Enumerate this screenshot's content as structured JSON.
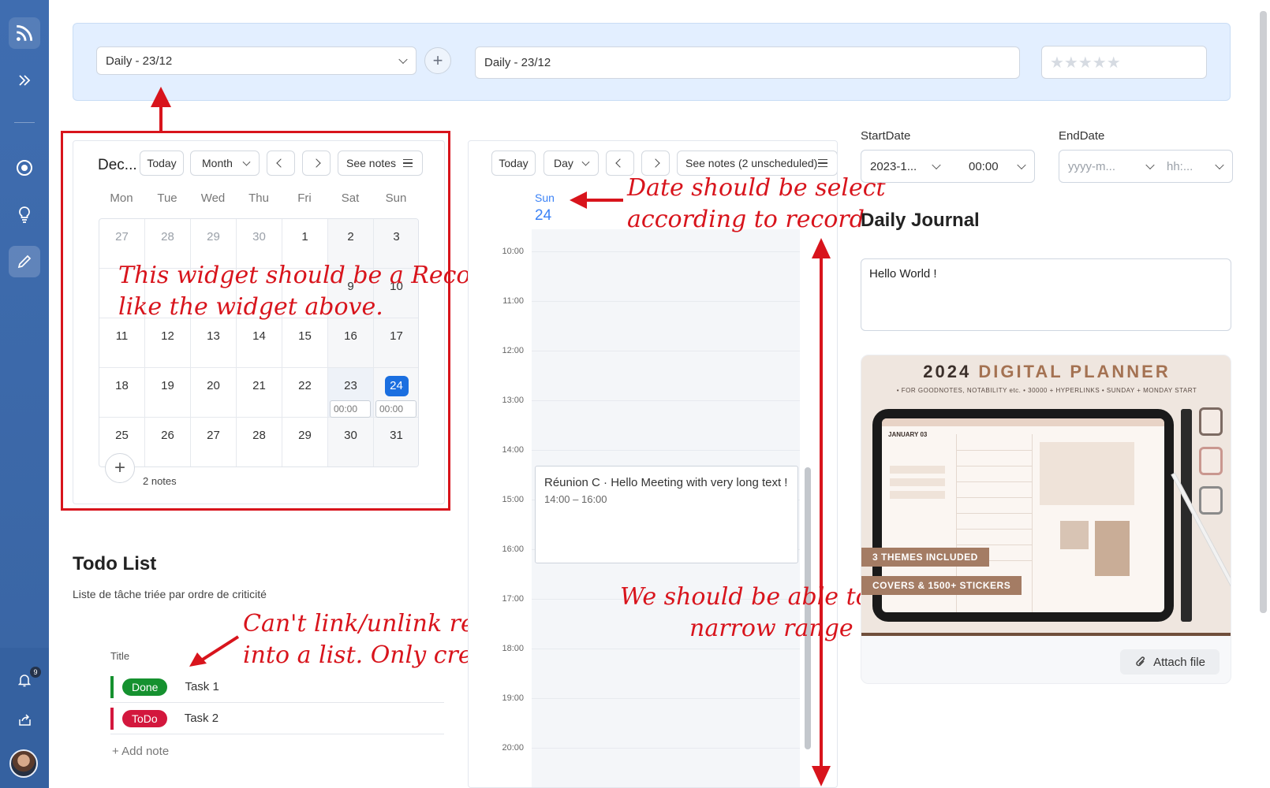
{
  "sidebar": {
    "notification_count": "9"
  },
  "topbar": {
    "record_select_value": "Daily - 23/12",
    "record_name_value": "Daily - 23/12",
    "rating_stars": "★★★★★"
  },
  "month_calendar": {
    "title": "Dec...",
    "today_label": "Today",
    "view_label": "Month",
    "see_notes_label": "See notes",
    "weekdays": [
      "Mon",
      "Tue",
      "Wed",
      "Thu",
      "Fri",
      "Sat",
      "Sun"
    ],
    "rows": [
      [
        "27",
        "28",
        "29",
        "30",
        "1",
        "2",
        "3"
      ],
      [
        "",
        "",
        "",
        "",
        "",
        "9",
        "10"
      ],
      [
        "11",
        "12",
        "13",
        "14",
        "15",
        "16",
        "17"
      ],
      [
        "18",
        "19",
        "20",
        "21",
        "22",
        "23",
        "24"
      ],
      [
        "25",
        "26",
        "27",
        "28",
        "29",
        "30",
        "31"
      ]
    ],
    "time_chip": "00:00",
    "notes_count": "2 notes"
  },
  "day_calendar": {
    "today_label": "Today",
    "view_label": "Day",
    "see_notes_label": "See notes (2 unscheduled)",
    "day_of_week": "Sun",
    "day_number": "24",
    "hours": [
      "10:00",
      "11:00",
      "12:00",
      "13:00",
      "14:00",
      "15:00",
      "16:00",
      "17:00",
      "18:00",
      "19:00",
      "20:00"
    ],
    "event": {
      "title": "Réunion C · Hello Meeting with very long text !",
      "time": "14:00 – 16:00"
    }
  },
  "todo": {
    "title": "Todo List",
    "subtitle": "Liste de tâche triée par ordre de criticité",
    "column_title": "Title",
    "items": [
      {
        "status": "Done",
        "task": "Task 1",
        "color": "#15912f"
      },
      {
        "status": "ToDo",
        "task": "Task 2",
        "color": "#d3173d"
      }
    ],
    "add_note_label": "Add note"
  },
  "details": {
    "start_label": "StartDate",
    "end_label": "EndDate",
    "start_date": "2023-1...",
    "start_time": "00:00",
    "end_date_placeholder": "yyyy-m...",
    "end_time_placeholder": "hh:...",
    "journal_title": "Daily Journal",
    "journal_text": "Hello World !"
  },
  "attachment": {
    "title_dark": "2024",
    "title_accent": "DIGITAL PLANNER",
    "subtitle": "• FOR GOODNOTES, NOTABILITY etc.    • 30000 + HYPERLINKS    • SUNDAY + MONDAY START",
    "banner_1": "3 THEMES INCLUDED",
    "banner_2": "COVERS & 1500+ STICKERS",
    "screen_month": "JANUARY 03",
    "attach_label": "Attach file"
  },
  "annotations": {
    "record_picker": [
      "This widget should be a Record Picker",
      "like the widget above."
    ],
    "date_select": [
      "Date should be select",
      "according to record"
    ],
    "narrow_range": [
      "We should be able to",
      "narrow range"
    ],
    "link_list": [
      "Can't link/unlink record",
      "into a list. Only create/Delete"
    ]
  },
  "colors": {
    "accent": "#1b6fe0",
    "annotation_red": "#d8141c",
    "sidebar": "#3d6aa8"
  }
}
